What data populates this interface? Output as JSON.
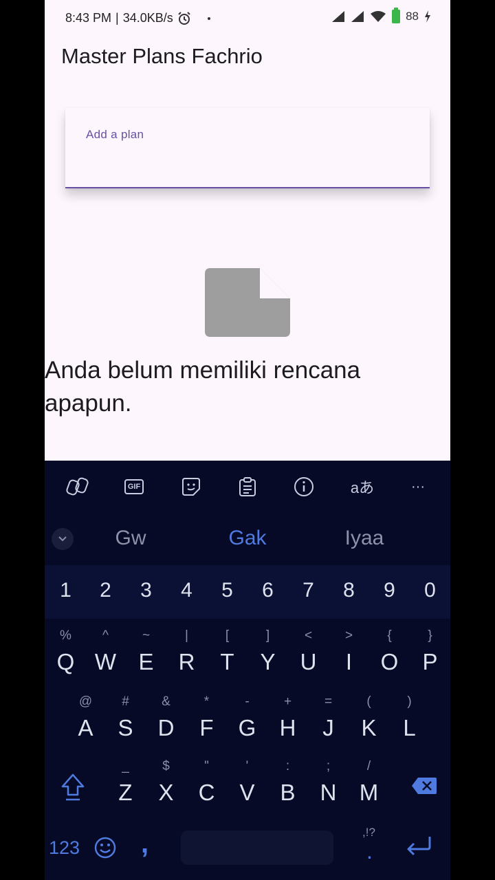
{
  "status_bar": {
    "time": "8:43 PM",
    "separator": "|",
    "speed": "34.0KB/s",
    "battery": "88",
    "icons": [
      "alarm-icon",
      "signal-icon",
      "signal-icon",
      "wifi-icon",
      "battery-icon",
      "charging-icon"
    ]
  },
  "app": {
    "title": "Master Plans Fachrio"
  },
  "input": {
    "label": "Add a plan",
    "value": ""
  },
  "empty_state": {
    "icon": "note-icon",
    "message": "Anda belum memiliki rencana apapun."
  },
  "keyboard": {
    "toolbar": [
      "copilot-icon",
      "gif-icon",
      "sticker-icon",
      "clipboard-icon",
      "info-icon",
      "translate-icon",
      "more-icon"
    ],
    "gif_label": "GIF",
    "translate_label": "aあ",
    "more_label": "···",
    "suggestions": [
      "Gw",
      "Gak",
      "Iyaa"
    ],
    "numbers": [
      "1",
      "2",
      "3",
      "4",
      "5",
      "6",
      "7",
      "8",
      "9",
      "0"
    ],
    "row1": [
      {
        "hint": "%",
        "key": "Q"
      },
      {
        "hint": "^",
        "key": "W"
      },
      {
        "hint": "~",
        "key": "E"
      },
      {
        "hint": "|",
        "key": "R"
      },
      {
        "hint": "[",
        "key": "T"
      },
      {
        "hint": "]",
        "key": "Y"
      },
      {
        "hint": "<",
        "key": "U"
      },
      {
        "hint": ">",
        "key": "I"
      },
      {
        "hint": "{",
        "key": "O"
      },
      {
        "hint": "}",
        "key": "P"
      }
    ],
    "row2": [
      {
        "hint": "@",
        "key": "A"
      },
      {
        "hint": "#",
        "key": "S"
      },
      {
        "hint": "&",
        "key": "D"
      },
      {
        "hint": "*",
        "key": "F"
      },
      {
        "hint": "-",
        "key": "G"
      },
      {
        "hint": "+",
        "key": "H"
      },
      {
        "hint": "=",
        "key": "J"
      },
      {
        "hint": "(",
        "key": "K"
      },
      {
        "hint": ")",
        "key": "L"
      }
    ],
    "row3": [
      {
        "hint": "_",
        "key": "Z"
      },
      {
        "hint": "$",
        "key": "X"
      },
      {
        "hint": "\"",
        "key": "C"
      },
      {
        "hint": "'",
        "key": "V"
      },
      {
        "hint": ":",
        "key": "B"
      },
      {
        "hint": ";",
        "key": "N"
      },
      {
        "hint": "/",
        "key": "M"
      }
    ],
    "key_123": "123",
    "comma": ",",
    "period": ".",
    "period_hint": ",!?",
    "accent_color": "#4f7be0"
  }
}
